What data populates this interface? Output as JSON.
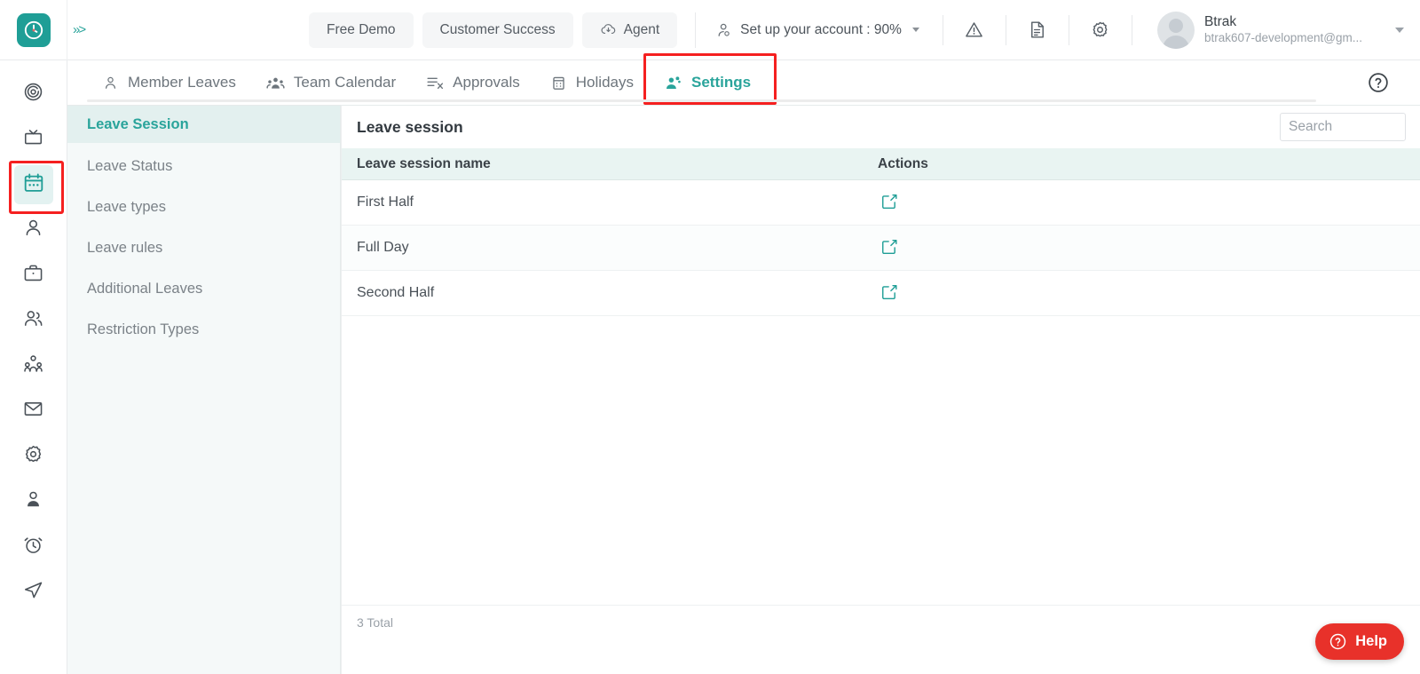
{
  "header": {
    "brand_icon": "clock-logo-icon",
    "expand_icon": "double-chevron-right-icon",
    "pills": [
      {
        "label": "Free Demo",
        "icon": null,
        "name": "free-demo-button"
      },
      {
        "label": "Customer Success",
        "icon": null,
        "name": "customer-success-button"
      },
      {
        "label": "Agent",
        "icon": "cloud-download-icon",
        "name": "agent-button"
      }
    ],
    "account_setup": {
      "label": "Set up your account : 90%",
      "icon": "user-settings-icon",
      "percent": "90%"
    },
    "icons": [
      {
        "name": "alert-triangle-icon"
      },
      {
        "name": "document-icon"
      },
      {
        "name": "gear-icon"
      }
    ],
    "user": {
      "name": "Btrak",
      "email": "btrak607-development@gm...",
      "avatar": "user-avatar-icon"
    }
  },
  "rail": {
    "items": [
      {
        "name": "target-icon",
        "active": false
      },
      {
        "name": "tv-icon",
        "active": false
      },
      {
        "name": "calendar-icon",
        "active": true,
        "annotated": true
      },
      {
        "name": "user-icon",
        "active": false
      },
      {
        "name": "briefcase-icon",
        "active": false
      },
      {
        "name": "users-icon",
        "active": false
      },
      {
        "name": "org-chart-icon",
        "active": false
      },
      {
        "name": "mail-icon",
        "active": false
      },
      {
        "name": "settings-gear-icon",
        "active": false
      },
      {
        "name": "person-badge-icon",
        "active": false
      },
      {
        "name": "alarm-clock-icon",
        "active": false
      },
      {
        "name": "send-icon",
        "active": false
      }
    ]
  },
  "tabs": {
    "items": [
      {
        "label": "Member Leaves",
        "icon": "person-icon",
        "active": false
      },
      {
        "label": "Team Calendar",
        "icon": "group-icon",
        "active": false
      },
      {
        "label": "Approvals",
        "icon": "approvals-icon",
        "active": false
      },
      {
        "label": "Holidays",
        "icon": "calendar-small-icon",
        "active": false
      },
      {
        "label": "Settings",
        "icon": "people-gear-icon",
        "active": true,
        "annotated": true
      }
    ],
    "help_icon": "question-circle-icon"
  },
  "submenu": {
    "items": [
      {
        "label": "Leave Session",
        "active": true
      },
      {
        "label": "Leave Status",
        "active": false
      },
      {
        "label": "Leave types",
        "active": false
      },
      {
        "label": "Leave rules",
        "active": false
      },
      {
        "label": "Additional Leaves",
        "active": false
      },
      {
        "label": "Restriction Types",
        "active": false
      }
    ]
  },
  "panel": {
    "title": "Leave session",
    "search_placeholder": "Search",
    "search_value": "",
    "columns": {
      "name": "Leave session name",
      "actions": "Actions"
    },
    "rows": [
      {
        "name": "First Half",
        "action_icon": "edit-pencil-icon"
      },
      {
        "name": "Full Day",
        "action_icon": "edit-pencil-icon"
      },
      {
        "name": "Second Half",
        "action_icon": "edit-pencil-icon"
      }
    ],
    "total": "3 Total"
  },
  "help_fab": {
    "label": "Help",
    "icon": "question-circle-icon",
    "color": "#e8312a"
  },
  "colors": {
    "accent": "#2aa49b",
    "brand": "#1f9e96",
    "annotation": "#f52020",
    "table_header_bg": "#e9f4f2",
    "submenu_bg": "#f5f9f9"
  }
}
